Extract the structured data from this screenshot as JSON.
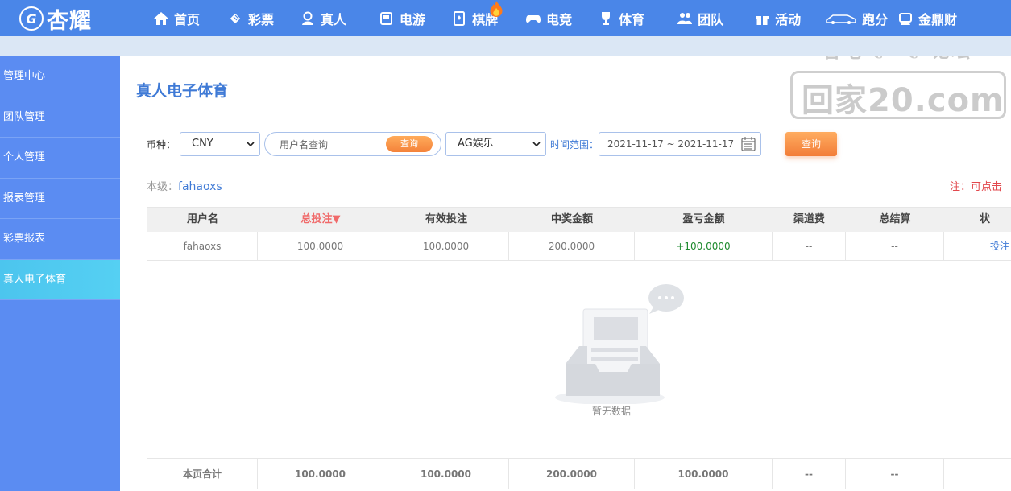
{
  "brand": {
    "logo_mark": "G",
    "name": "杏耀"
  },
  "nav": [
    {
      "label": "首页",
      "icon": "home-icon"
    },
    {
      "label": "彩票",
      "icon": "ticket-icon"
    },
    {
      "label": "真人",
      "icon": "dealer-icon"
    },
    {
      "label": "电游",
      "icon": "slot-machine-icon"
    },
    {
      "label": "棋牌",
      "icon": "cards-icon",
      "hot": true
    },
    {
      "label": "电竞",
      "icon": "gamepad-icon"
    },
    {
      "label": "体育",
      "icon": "trophy-icon"
    },
    {
      "label": "团队",
      "icon": "team-icon"
    },
    {
      "label": "活动",
      "icon": "gift-icon"
    },
    {
      "label": "跑分",
      "icon": "car-icon"
    },
    {
      "label": "金鼎财",
      "icon": "money-icon"
    }
  ],
  "sidebar": {
    "items": [
      {
        "label": "管理中心",
        "active": false
      },
      {
        "label": "团队管理",
        "active": false
      },
      {
        "label": "个人管理",
        "active": false
      },
      {
        "label": "报表管理",
        "active": false
      },
      {
        "label": "彩票报表",
        "active": false
      },
      {
        "label": "真人电子体育",
        "active": true
      }
    ]
  },
  "page": {
    "title": "真人电子体育"
  },
  "watermark": {
    "top_left": "杏吧",
    "top_right": "论坛",
    "main": "回家20.com"
  },
  "filters": {
    "currency_label": "币种：",
    "currency_value": "CNY",
    "username_placeholder": "用户名查询",
    "username_search_label": "查询",
    "platform_value": "AG娱乐",
    "time_label": "时间范围：",
    "date_range": "2021-11-17 ~ 2021-11-17",
    "query_label": "查询"
  },
  "level": {
    "label": "本级：",
    "user": "fahaoxs"
  },
  "note": "注：可点击",
  "table": {
    "headers": [
      "用户名",
      "总投注▼",
      "有效投注",
      "中奖金额",
      "盈亏金额",
      "渠道费",
      "总结算",
      "状"
    ],
    "rows": [
      [
        "fahaoxs",
        "100.0000",
        "100.0000",
        "200.0000",
        "+100.0000",
        "--",
        "--",
        "投注"
      ]
    ],
    "empty_text": "暂无数据",
    "summary": [
      "本页合计",
      "100.0000",
      "100.0000",
      "200.0000",
      "100.0000",
      "--",
      "--",
      "--"
    ]
  },
  "colors": {
    "nav_bg": "#4a86e8",
    "sidebar_bg": "#5b8cf2",
    "active_item": "#4cc5ee",
    "accent_orange": "#f4823a",
    "profit_green": "#1e8a2e"
  }
}
